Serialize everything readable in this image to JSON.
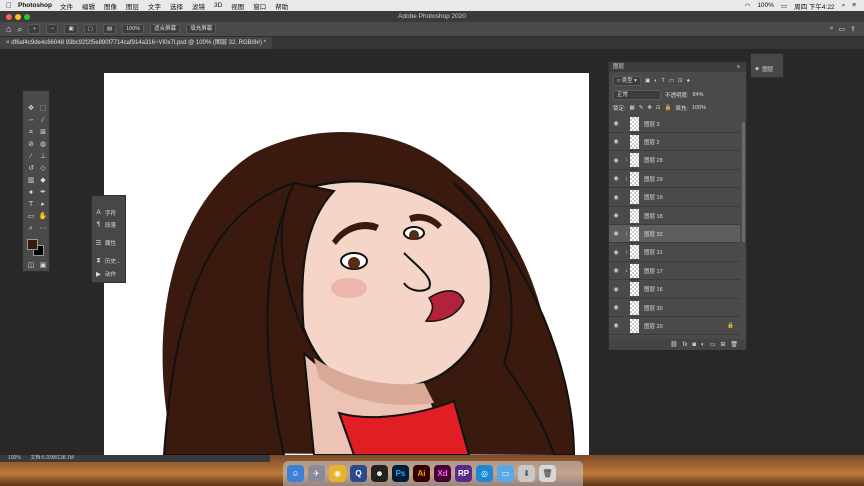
{
  "menubar": {
    "apple": "",
    "app_name": "Photoshop",
    "menus": [
      "文件",
      "编辑",
      "图像",
      "图层",
      "文字",
      "选择",
      "滤镜",
      "3D",
      "视图",
      "窗口",
      "帮助"
    ],
    "battery": "100%",
    "clock": "周四 下午4:22"
  },
  "window": {
    "title": "Adobe Photoshop 2020"
  },
  "options_bar": {
    "zoom_level": "100%",
    "fit_screen_label": "适合屏幕",
    "fill_screen_label": "填充屏幕"
  },
  "document_tab": {
    "label": "df6af4c9de4c66048 93bc92f2f5e890f7714caf914a316~VI0x7l.psd @ 100% (图层 32, RGB/8#) *"
  },
  "mini_panel": {
    "items": [
      {
        "icon": "character-icon",
        "label": "字符"
      },
      {
        "icon": "paragraph-icon",
        "label": "段落"
      },
      {
        "icon": "properties-icon",
        "label": "属性"
      },
      {
        "icon": "history-icon",
        "label": "历史..."
      },
      {
        "icon": "actions-icon",
        "label": "动作"
      }
    ]
  },
  "layers_panel": {
    "title": "图层",
    "filter_label": "类型",
    "blend_mode": "正常",
    "opacity_label": "不透明度:",
    "opacity_value": "84%",
    "lock_label": "锁定:",
    "fill_label": "填充:",
    "fill_value": "100%",
    "layers": [
      {
        "name": "图层 3",
        "clipped": false,
        "selected": false,
        "locked": false
      },
      {
        "name": "图层 2",
        "clipped": false,
        "selected": false,
        "locked": false
      },
      {
        "name": "图层 28",
        "clipped": true,
        "selected": false,
        "locked": false
      },
      {
        "name": "图层 29",
        "clipped": true,
        "selected": false,
        "locked": false
      },
      {
        "name": "图层 19",
        "clipped": false,
        "selected": false,
        "locked": false
      },
      {
        "name": "图层 18",
        "clipped": false,
        "selected": false,
        "locked": false
      },
      {
        "name": "图层 32",
        "clipped": true,
        "selected": true,
        "locked": false
      },
      {
        "name": "图层 31",
        "clipped": true,
        "selected": false,
        "locked": false
      },
      {
        "name": "图层 17",
        "clipped": true,
        "selected": false,
        "locked": false
      },
      {
        "name": "图层 16",
        "clipped": false,
        "selected": false,
        "locked": false
      },
      {
        "name": "图层 30",
        "clipped": false,
        "selected": false,
        "locked": false
      },
      {
        "name": "图层 20",
        "clipped": false,
        "selected": false,
        "locked": true
      }
    ]
  },
  "right_panel": {
    "label": "图层"
  },
  "status_bar": {
    "zoom": "100%",
    "doc_size": "文档:6.93M/138.1M"
  },
  "dock": {
    "apps": [
      "finder",
      "launchpad",
      "chrome",
      "quicktime",
      "qq",
      "Ps",
      "Ai",
      "Xd",
      "RP",
      "safari",
      "folder",
      "trash"
    ]
  },
  "colors": {
    "hair": "#3a1a0e",
    "skin": "#f4d5c8",
    "lips": "#b2223a",
    "collar": "#e01e24",
    "foreground_swatch": "#3a1a0e",
    "background_swatch": "#000000"
  }
}
